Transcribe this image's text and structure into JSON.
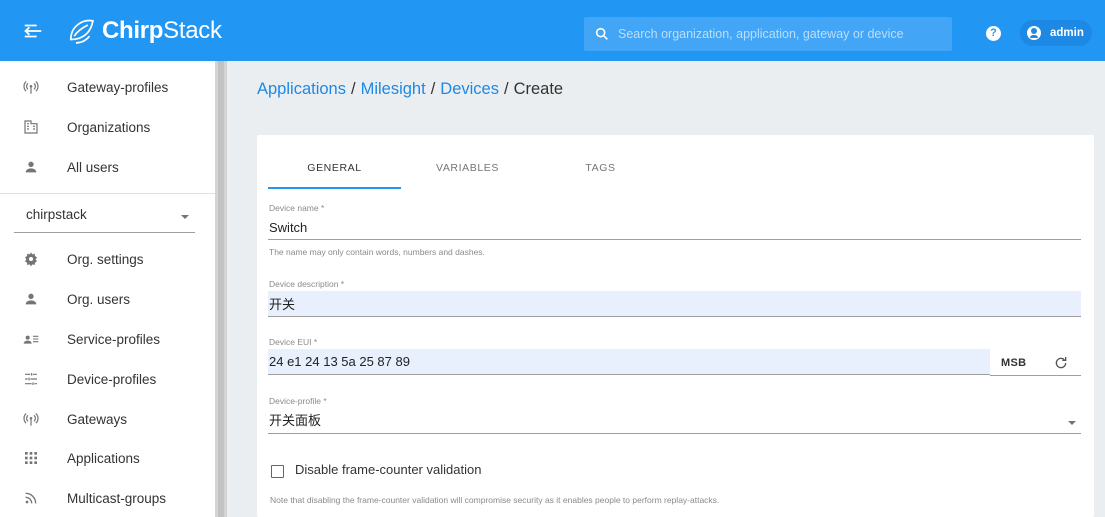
{
  "app": {
    "logo_bold": "Chirp",
    "logo_regular": "Stack"
  },
  "topbar": {
    "search_placeholder": "Search organization, application, gateway or device",
    "help_label": "?",
    "user_name": "admin"
  },
  "sidebar": {
    "global_items": [
      {
        "label": "Gateway-profiles",
        "icon": "antenna-icon"
      },
      {
        "label": "Organizations",
        "icon": "building-icon"
      },
      {
        "label": "All users",
        "icon": "person-icon"
      }
    ],
    "org_select_value": "chirpstack",
    "org_items": [
      {
        "label": "Org. settings",
        "icon": "gear-icon"
      },
      {
        "label": "Org. users",
        "icon": "person-icon"
      },
      {
        "label": "Service-profiles",
        "icon": "account-details-icon"
      },
      {
        "label": "Device-profiles",
        "icon": "tune-icon"
      },
      {
        "label": "Gateways",
        "icon": "antenna-icon"
      },
      {
        "label": "Applications",
        "icon": "apps-grid-icon"
      },
      {
        "label": "Multicast-groups",
        "icon": "rss-icon"
      }
    ]
  },
  "breadcrumb": {
    "items": [
      "Applications",
      "Milesight",
      "Devices"
    ],
    "current": "Create",
    "separator": "/"
  },
  "tabs": [
    {
      "label": "GENERAL",
      "active": true
    },
    {
      "label": "VARIABLES",
      "active": false
    },
    {
      "label": "TAGS",
      "active": false
    }
  ],
  "form": {
    "device_name": {
      "label": "Device name *",
      "value": "Switch",
      "help": "The name may only contain words, numbers and dashes."
    },
    "device_description": {
      "label": "Device description *",
      "value": "开关"
    },
    "device_eui": {
      "label": "Device EUI *",
      "value": "24 e1 24 13 5a 25 87 89",
      "byte_order": "MSB"
    },
    "device_profile": {
      "label": "Device-profile *",
      "value": "开关面板"
    },
    "frame_counter": {
      "label": "Disable frame-counter validation",
      "checked": false,
      "note": "Note that disabling the frame-counter validation will compromise security as it enables people to perform replay-attacks."
    }
  },
  "colors": {
    "primary": "#2196f3",
    "link": "#1e88e5",
    "autofill": "#e8f0fe"
  }
}
